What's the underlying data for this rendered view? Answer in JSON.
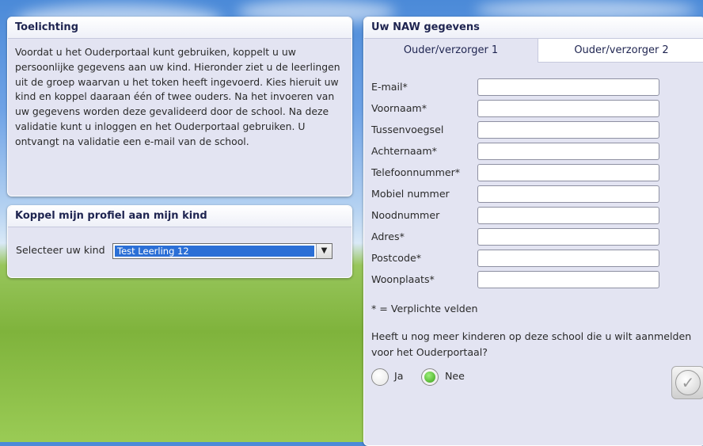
{
  "toelichting": {
    "title": "Toelichting",
    "lines": [
      "Voordat u het Ouderportaal kunt gebruiken, koppelt u uw",
      "persoonlijke gegevens aan uw kind. Hieronder ziet u de leerlingen",
      "uit de groep waarvan u het token heeft ingevoerd. Kies hieruit uw",
      "kind en koppel daaraan één of twee ouders. Na het invoeren van",
      "uw gegevens worden deze gevalideerd door de school. Na deze",
      "validatie kunt u inloggen en het Ouderportaal gebruiken. U",
      "ontvangt na validatie een e-mail van de school."
    ]
  },
  "koppel": {
    "title": "Koppel mijn profiel aan mijn kind",
    "select_label": "Selecteer uw kind",
    "selected_child": "Test Leerling 12"
  },
  "naw": {
    "title": "Uw NAW gegevens",
    "tabs": [
      "Ouder/verzorger 1",
      "Ouder/verzorger 2"
    ],
    "fields": [
      {
        "label": "E-mail*",
        "value": ""
      },
      {
        "label": "Voornaam*",
        "value": ""
      },
      {
        "label": "Tussenvoegsel",
        "value": ""
      },
      {
        "label": "Achternaam*",
        "value": ""
      },
      {
        "label": "Telefoonnummer*",
        "value": ""
      },
      {
        "label": "Mobiel nummer",
        "value": ""
      },
      {
        "label": "Noodnummer",
        "value": ""
      },
      {
        "label": "Adres*",
        "value": ""
      },
      {
        "label": "Postcode*",
        "value": ""
      },
      {
        "label": "Woonplaats*",
        "value": ""
      }
    ],
    "required_note": "* = Verplichte velden",
    "question_line1": "Heeft u nog meer kinderen op deze school die u wilt aanmelden",
    "question_line2": "voor het Ouderportaal?",
    "radio_yes": "Ja",
    "radio_no": "Nee",
    "selected_option": "Nee"
  },
  "colors": {
    "panel_bg": "#e3e4f2",
    "title_text": "#1e2450",
    "select_highlight": "#2b6fd6",
    "radio_selected": "#3aa018"
  },
  "icons": {
    "dropdown": "chevron-down-icon",
    "confirm": "checkmark-icon"
  }
}
